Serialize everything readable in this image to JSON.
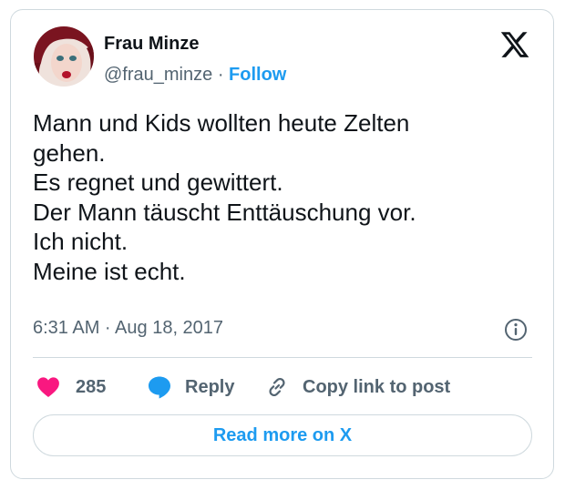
{
  "tweet": {
    "author_name": "Frau Minze",
    "handle": "@frau_minze",
    "separator": "·",
    "follow_label": "Follow",
    "text_lines": [
      "Mann und Kids wollten heute Zelten",
      "gehen.",
      "Es regnet und gewittert.",
      "Der Mann täuscht Enttäuschung vor.",
      "Ich nicht.",
      "Meine ist echt."
    ],
    "timestamp": "6:31 AM · Aug 18, 2017",
    "like_count": "285",
    "reply_label": "Reply",
    "copy_link_label": "Copy link to post",
    "read_more_label": "Read more on X"
  },
  "icons": {
    "logo": "x-logo-icon",
    "info": "info-icon",
    "like": "heart-icon",
    "reply": "speech-bubble-icon",
    "copy": "link-icon"
  },
  "colors": {
    "accent": "#1d9bf0",
    "heart": "#f91880",
    "secondary_text": "#536471",
    "border": "#cfd9de"
  }
}
